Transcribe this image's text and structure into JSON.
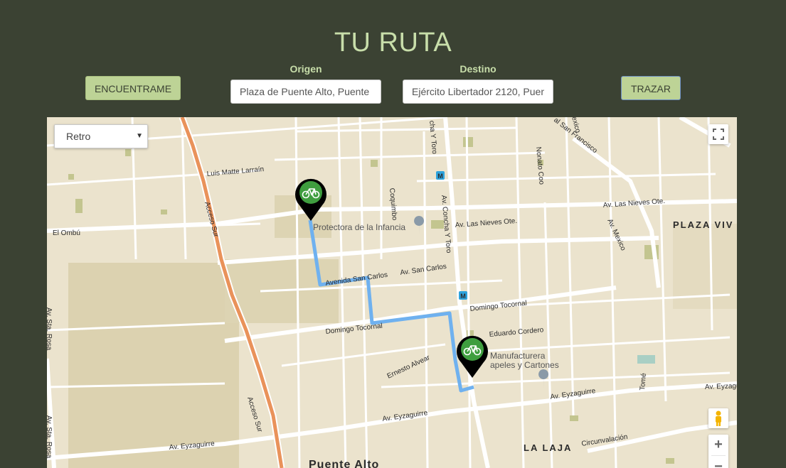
{
  "header": {
    "title": "TU RUTA"
  },
  "controls": {
    "locate_label": "ENCUENTRAME",
    "trace_label": "TRAZAR",
    "origin_label": "Origen",
    "origin_value": "Plaza de Puente Alto, Puente",
    "destination_label": "Destino",
    "destination_value": "Ejército Libertador 2120, Puen"
  },
  "map": {
    "style_value": "Retro",
    "labels": {
      "luis_matte": "Luis Matte Larraín",
      "acceso_sur_1": "Acceso Sur",
      "acceso_sur_2": "Acceso Sur",
      "el_ombu": "El Ombú",
      "coquimbo": "Coquimbo",
      "protectora": "Protectora de la Infancia",
      "las_nieves": "Av. Las Nieves Ote.",
      "av_concha": "Av. Concha Y Toro",
      "concha_top": "cha Y Toro",
      "av_mexico": "Av. Mexico",
      "mexico_top": "exico",
      "san_francisco": "al San Francisco",
      "nonato": "Nonato Coo",
      "plaza_viva": "PLAZA VIV",
      "avenida_san_carlos": "Avenida San Carlos",
      "av_san_carlos": "Av. San Carlos",
      "domingo_tocornal_1": "Domingo Tocornal",
      "domingo_tocornal_2": "Domingo Tocornal",
      "eduardo_cordero": "Eduardo Cordero",
      "ernesto_alvear": "Ernesto Alvear",
      "manufacturera_1": "Manufacturera",
      "manufacturera_2": "apeles y Cartones",
      "av_eyzaguirre_1": "Av. Eyzaguirre",
      "av_eyzaguirre_2": "Av. Eyzaguirre",
      "av_eyzaguirre_3": "Av. Eyzaguirre",
      "av_eyzaguirre_4": "Av. Eyzaguirre",
      "tome": "Tomé",
      "la_laja": "LA LAJA",
      "circunvalacion": "Circunvalación",
      "puente_alto": "Puente Alto",
      "sta_rosa_1": "Av. Sta. Rosa",
      "sta_rosa_2": "Av. Sta. Rosa",
      "metro": "M"
    },
    "colors": {
      "background": "#ebe3cd",
      "road": "#ffffff",
      "highway": "#e9925a",
      "route": "#6fb1ef",
      "marker": "#000000",
      "marker_inner": "#3f9e3f",
      "page": "#3b4233",
      "accent": "#bdd396"
    },
    "icons": {
      "origin_marker": "bicycle-marker-icon",
      "destination_marker": "bicycle-marker-icon",
      "fullscreen": "fullscreen-icon",
      "pegman": "pegman-icon",
      "zoom_in": "+",
      "zoom_out": "−"
    }
  }
}
